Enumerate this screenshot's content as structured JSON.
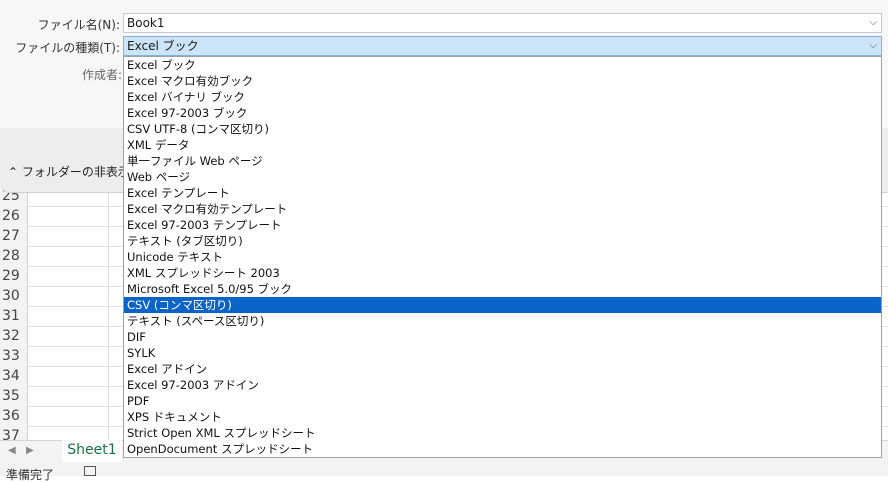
{
  "dialog": {
    "filename_label": "ファイル名(N):",
    "filename_value": "Book1",
    "filetype_label": "ファイルの種類(T):",
    "filetype_value": "Excel ブック",
    "author_label": "作成者:",
    "folder_toggle": "フォルダーの非表示"
  },
  "dropdown": {
    "selected_index": 15,
    "options": [
      "Excel ブック",
      "Excel マクロ有効ブック",
      "Excel バイナリ ブック",
      "Excel 97-2003 ブック",
      "CSV UTF-8 (コンマ区切り)",
      "XML データ",
      "単一ファイル Web ページ",
      "Web ページ",
      "Excel テンプレート",
      "Excel マクロ有効テンプレート",
      "Excel 97-2003 テンプレート",
      "テキスト (タブ区切り)",
      "Unicode テキスト",
      "XML スプレッドシート 2003",
      "Microsoft Excel 5.0/95 ブック",
      "CSV (コンマ区切り)",
      "テキスト (スペース区切り)",
      "DIF",
      "SYLK",
      "Excel アドイン",
      "Excel 97-2003 アドイン",
      "PDF",
      "XPS ドキュメント",
      "Strict Open XML スプレッドシート",
      "OpenDocument スプレッドシート"
    ]
  },
  "sheet": {
    "rows": [
      "25",
      "26",
      "27",
      "28",
      "29",
      "30",
      "31",
      "32",
      "33",
      "34",
      "35",
      "36",
      "37"
    ],
    "tab_name": "Sheet1"
  },
  "status": {
    "text": "準備完了"
  },
  "colors": {
    "accent": "#0a64c8",
    "sheet_tab": "#1e7145",
    "field_selected": "#cce4f7"
  }
}
